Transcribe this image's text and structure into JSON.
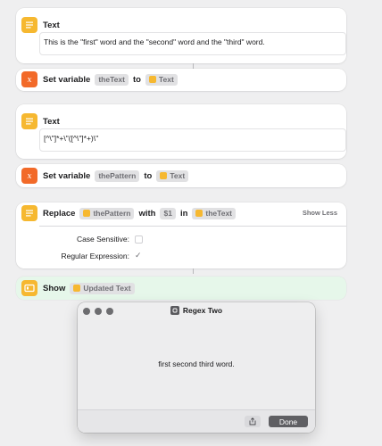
{
  "actions": {
    "text1": {
      "title": "Text",
      "value": "This is the \"first\" word and the \"second\" word and the \"third\" word."
    },
    "setvar1": {
      "title": "Set variable",
      "variable": "theText",
      "to_word": "to",
      "value_token": "Text"
    },
    "text2": {
      "title": "Text",
      "value": "[^\\\"]*+\\\"([^\\\"]*+)\\\""
    },
    "setvar2": {
      "title": "Set variable",
      "variable": "thePattern",
      "to_word": "to",
      "value_token": "Text"
    },
    "replace": {
      "title": "Replace",
      "pattern_token": "thePattern",
      "with_word": "with",
      "replacement_token": "$1",
      "in_word": "in",
      "input_token": "theText",
      "toggle_label": "Show Less",
      "case_sensitive_label": "Case Sensitive:",
      "regex_label": "Regular Expression:",
      "case_sensitive": false,
      "regex": true
    },
    "show": {
      "title": "Show",
      "token": "Updated Text"
    }
  },
  "dialog": {
    "title": "Regex Two",
    "message": "first second third  word.",
    "done_label": "Done"
  },
  "colors": {
    "text_icon": "#f6b830",
    "variable_icon": "#f26a29",
    "show_card_bg": "#e6f7ea",
    "done_button": "#5f5f63"
  },
  "icons": {
    "text_action": "text-lines-icon",
    "variable_action": "x-variable-icon",
    "show_action": "show-result-icon",
    "share": "share-icon"
  }
}
